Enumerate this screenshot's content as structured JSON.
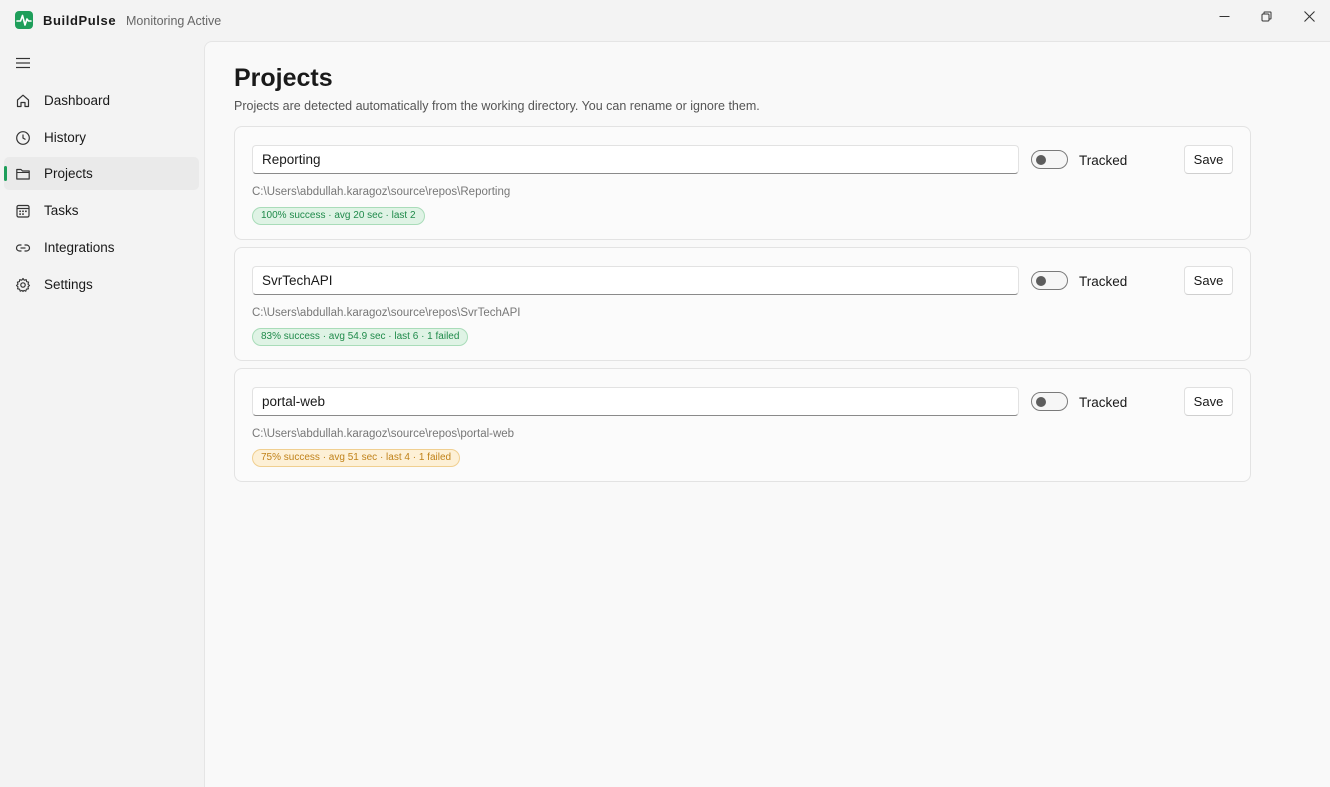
{
  "app": {
    "name": "BuildPulse",
    "status": "Monitoring Active",
    "accent_color": "#1e9e5a"
  },
  "sidebar": {
    "items": [
      {
        "label": "Dashboard",
        "icon": "home-icon",
        "active": false
      },
      {
        "label": "History",
        "icon": "clock-icon",
        "active": false
      },
      {
        "label": "Projects",
        "icon": "folder-icon",
        "active": true
      },
      {
        "label": "Tasks",
        "icon": "calendar-icon",
        "active": false
      },
      {
        "label": "Integrations",
        "icon": "link-icon",
        "active": false
      },
      {
        "label": "Settings",
        "icon": "gear-icon",
        "active": false
      }
    ]
  },
  "page": {
    "title": "Projects",
    "subtitle": "Projects are detected automatically from the working directory. You can rename or ignore them."
  },
  "projects": [
    {
      "name": "Reporting",
      "tracked_label": "Tracked",
      "tracked": false,
      "save_label": "Save",
      "path": "C:\\Users\\abdullah.karagoz\\source\\repos\\Reporting",
      "stats": "100% success · avg 20 sec · last 2",
      "stats_status": "good"
    },
    {
      "name": "SvrTechAPI",
      "tracked_label": "Tracked",
      "tracked": false,
      "save_label": "Save",
      "path": "C:\\Users\\abdullah.karagoz\\source\\repos\\SvrTechAPI",
      "stats": "83% success · avg 54.9 sec · last 6 · 1 failed",
      "stats_status": "good"
    },
    {
      "name": "portal-web",
      "tracked_label": "Tracked",
      "tracked": false,
      "save_label": "Save",
      "path": "C:\\Users\\abdullah.karagoz\\source\\repos\\portal-web",
      "stats": "75% success · avg 51 sec · last 4 · 1 failed",
      "stats_status": "warn"
    }
  ]
}
